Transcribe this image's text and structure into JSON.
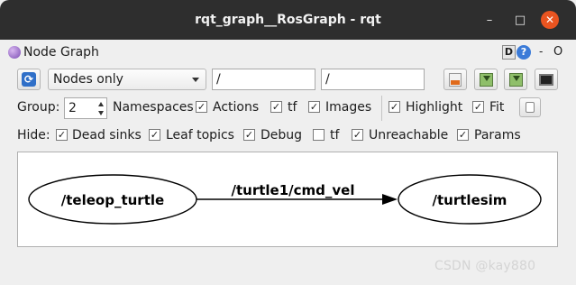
{
  "window": {
    "title": "rqt_graph__RosGraph - rqt",
    "minimize_glyph": "–",
    "maximize_glyph": "□",
    "close_glyph": "✕"
  },
  "plugin": {
    "title": "Node Graph",
    "d_label": "D",
    "help_label": "?",
    "dash_label": "-",
    "o_label": "O"
  },
  "toolbar": {
    "refresh_icon": "refresh-icon",
    "mode_selected": "Nodes only",
    "filter_namespace": "/",
    "filter_topic": "/"
  },
  "group_row": {
    "group_label": "Group:",
    "group_value": "2",
    "namespaces_label": "Namespaces",
    "actions": {
      "label": "Actions",
      "checked": true
    },
    "tf": {
      "label": "tf",
      "checked": true
    },
    "images": {
      "label": "Images",
      "checked": true
    },
    "highlight": {
      "label": "Highlight",
      "checked": true
    },
    "fit": {
      "label": "Fit",
      "checked": true
    }
  },
  "hide_row": {
    "hide_label": "Hide:",
    "dead_sinks": {
      "label": "Dead sinks",
      "checked": true
    },
    "leaf_topics": {
      "label": "Leaf topics",
      "checked": true
    },
    "debug": {
      "label": "Debug",
      "checked": true
    },
    "tf": {
      "label": "tf",
      "checked": false
    },
    "unreachable": {
      "label": "Unreachable",
      "checked": true
    },
    "params": {
      "label": "Params",
      "checked": true
    }
  },
  "graph": {
    "source_node": "/teleop_turtle",
    "edge_label": "/turtle1/cmd_vel",
    "target_node": "/turtlesim"
  },
  "watermark": "CSDN @kay880"
}
